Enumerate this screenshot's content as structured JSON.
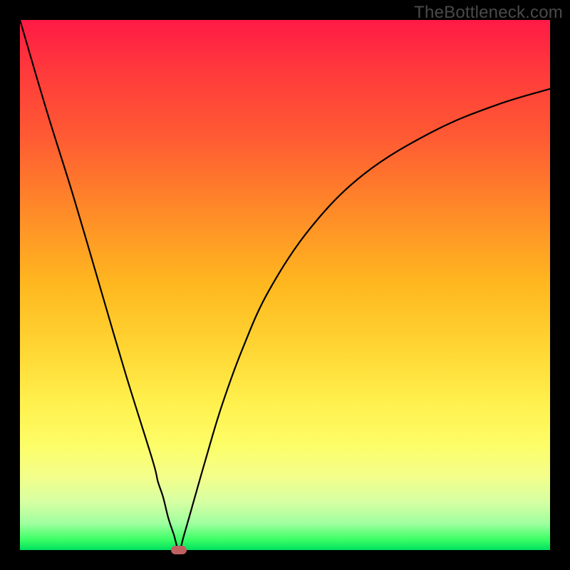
{
  "watermark": "TheBottleneck.com",
  "chart_data": {
    "type": "line",
    "title": "",
    "xlabel": "",
    "ylabel": "",
    "xlim": [
      0,
      100
    ],
    "ylim": [
      0,
      100
    ],
    "grid": false,
    "series": [
      {
        "name": "curve",
        "x": [
          0,
          5,
          10,
          15,
          20,
          25,
          26,
          27,
          28,
          29,
          30,
          31,
          33,
          35,
          38,
          42,
          47,
          55,
          65,
          78,
          90,
          100
        ],
        "y": [
          100,
          83,
          67,
          50,
          33,
          17,
          13,
          10,
          6,
          3,
          0,
          3,
          10,
          17,
          27,
          38,
          49,
          61,
          71,
          79,
          84,
          87
        ]
      }
    ],
    "marker": {
      "x": 30,
      "y": 0,
      "color": "#c06060"
    },
    "gradient_stops": [
      {
        "pos": 0,
        "color": "#ff1a46"
      },
      {
        "pos": 10,
        "color": "#ff3b3b"
      },
      {
        "pos": 22,
        "color": "#ff5a33"
      },
      {
        "pos": 36,
        "color": "#ff8a28"
      },
      {
        "pos": 50,
        "color": "#ffb81f"
      },
      {
        "pos": 62,
        "color": "#ffd633"
      },
      {
        "pos": 72,
        "color": "#fff04d"
      },
      {
        "pos": 80,
        "color": "#fdfd66"
      },
      {
        "pos": 86,
        "color": "#f4ff8a"
      },
      {
        "pos": 91,
        "color": "#d6ffa3"
      },
      {
        "pos": 95,
        "color": "#9fff9f"
      },
      {
        "pos": 98,
        "color": "#3cff66"
      },
      {
        "pos": 100,
        "color": "#00e060"
      }
    ]
  }
}
